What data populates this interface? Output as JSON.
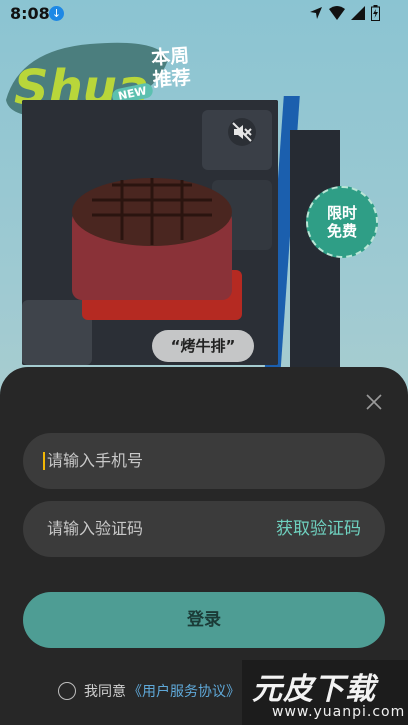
{
  "status_bar": {
    "time": "8:08"
  },
  "banner": {
    "logo_text": "Shua",
    "new_badge": "NEW",
    "weekly_label_line1": "本周",
    "weekly_label_line2": "推荐",
    "food_tag": "“烤牛排”",
    "free_badge_line1": "限时",
    "free_badge_line2": "免费"
  },
  "login": {
    "phone_placeholder": "请输入手机号",
    "code_placeholder": "请输入验证码",
    "get_code_label": "获取验证码",
    "login_button": "登录",
    "agree_text": "我同意",
    "agreement_link": "《用户服务协议》"
  },
  "watermark": {
    "title": "元皮下载",
    "url": "www.yuanpi.com"
  },
  "colors": {
    "accent": "#6fd2c0",
    "button": "#4e9d94",
    "sheet": "#272727"
  }
}
